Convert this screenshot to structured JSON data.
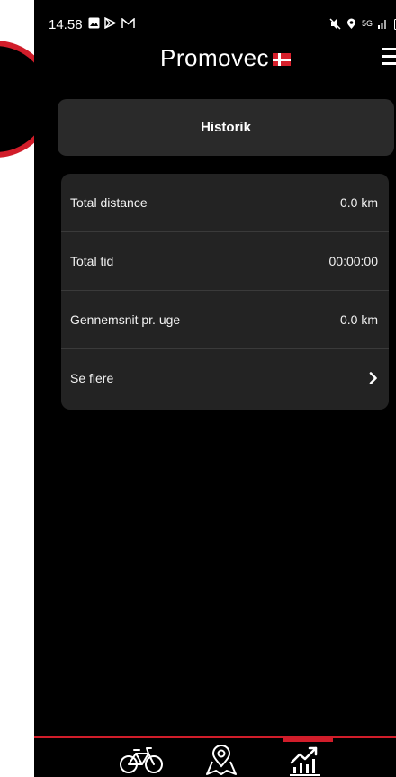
{
  "status": {
    "time": "14.58",
    "left_icons": [
      "image-icon",
      "play-icon",
      "mail-icon"
    ],
    "right_icons": [
      "mute-icon",
      "location-icon",
      "5g-icon",
      "signal-icon",
      "battery-icon"
    ]
  },
  "header": {
    "logo": "Promovec",
    "flag": "danish-flag-icon"
  },
  "page": {
    "title": "Historik"
  },
  "stats": {
    "rows": [
      {
        "label": "Total distance",
        "value": "0.0 km"
      },
      {
        "label": "Total tid",
        "value": "00:00:00"
      },
      {
        "label": "Gennemsnit pr. uge",
        "value": "0.0 km"
      },
      {
        "label": "Se flere",
        "value": ""
      }
    ]
  },
  "nav": {
    "items": [
      "bicycle-icon",
      "map-pin-icon",
      "stats-chart-icon"
    ],
    "active": "stats-chart-icon"
  },
  "colors": {
    "accent": "#d11d2a",
    "background": "#000000",
    "card": "#2a2a2a"
  }
}
